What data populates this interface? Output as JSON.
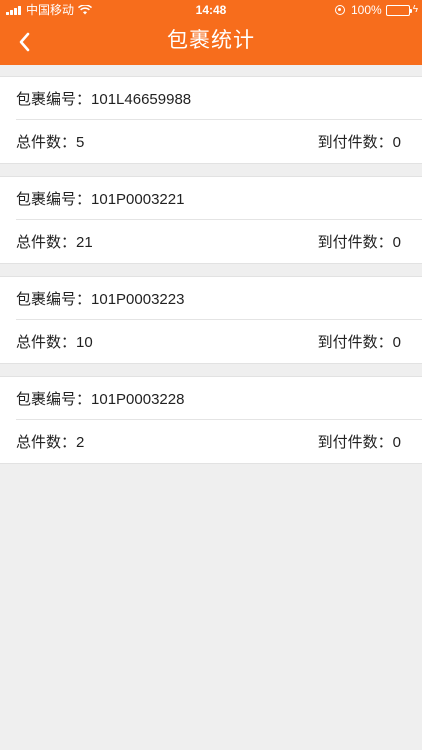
{
  "status_bar": {
    "carrier": "中国移动",
    "time": "14:48",
    "battery": "100%"
  },
  "nav": {
    "title": "包裹统计",
    "back_icon": "chevron-left-icon"
  },
  "colors": {
    "accent": "#f76d1c",
    "background": "#efefef",
    "card": "#ffffff"
  },
  "labels": {
    "package_no": "包裹编号：",
    "total": "总件数：",
    "cod": "到付件数："
  },
  "packages": [
    {
      "no": "101L46659988",
      "total": "5",
      "cod": "0"
    },
    {
      "no": "101P0003221",
      "total": "21",
      "cod": "0"
    },
    {
      "no": "101P0003223",
      "total": "10",
      "cod": "0"
    },
    {
      "no": "101P0003228",
      "total": "2",
      "cod": "0"
    }
  ]
}
